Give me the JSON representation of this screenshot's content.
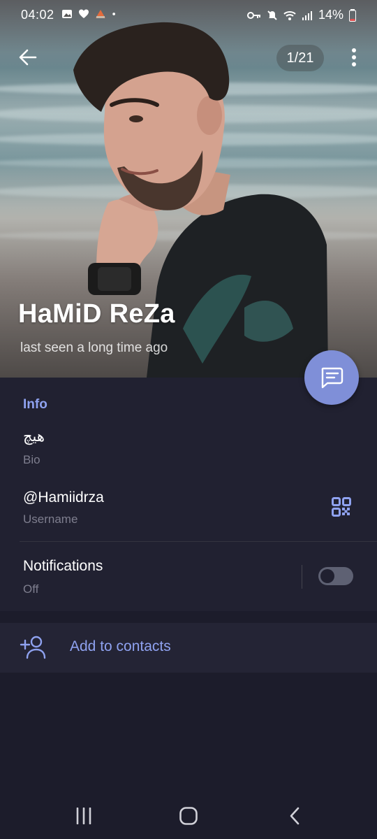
{
  "status_bar": {
    "time": "04:02",
    "battery": "14%",
    "left_icons": [
      "gallery-icon",
      "heart-icon",
      "app-notification-icon",
      "dot-icon"
    ],
    "right_icons": [
      "key-icon",
      "mute-icon",
      "wifi-icon",
      "signal-icon",
      "battery-icon"
    ]
  },
  "header": {
    "photo_counter": "1/21",
    "name": "HaMiD ReZa",
    "last_seen": "last seen a long time ago"
  },
  "info": {
    "section_title": "Info",
    "bio_value": "هیچ",
    "bio_label": "Bio",
    "username_value": "@Hamiidrza",
    "username_label": "Username",
    "notifications_label": "Notifications",
    "notifications_state": "Off",
    "notifications_enabled": false
  },
  "actions": {
    "add_to_contacts": "Add to contacts"
  },
  "colors": {
    "accent": "#8fa2f0",
    "fab": "#7f8fd8",
    "background": "#1c1c2b",
    "card": "#212131"
  }
}
